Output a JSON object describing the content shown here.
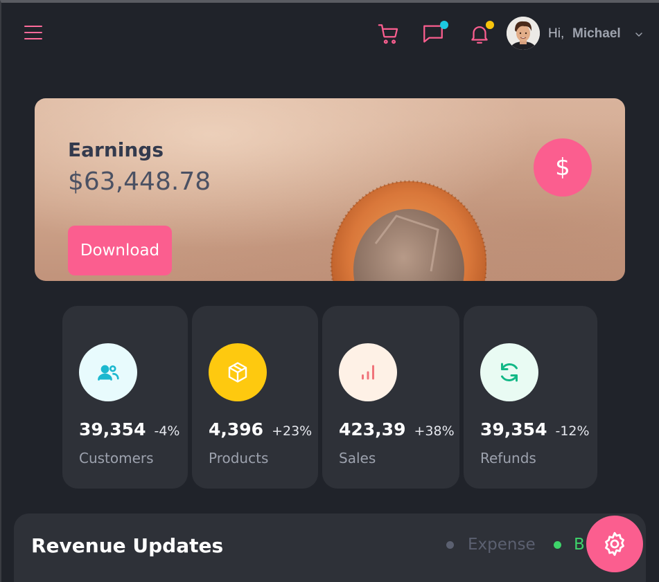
{
  "header": {
    "greeting": "Hi,",
    "user_name": "Michael",
    "icons": [
      "menu-icon",
      "cart-icon",
      "chat-icon",
      "bell-icon",
      "chevron-down-icon"
    ],
    "chat_badge_color": "#1cc8e0",
    "bell_badge_color": "#f8c50c"
  },
  "earnings": {
    "title": "Earnings",
    "value": "$63,448.78",
    "button_label": "Download",
    "icon_symbol": "$"
  },
  "stats": [
    {
      "value": "39,354",
      "change": "-4%",
      "label": "Customers",
      "icon": "customers-icon",
      "icon_bg": "#e8fbfd",
      "icon_color": "#1cb8cf"
    },
    {
      "value": "4,396",
      "change": "+23%",
      "label": "Products",
      "icon": "box-icon",
      "icon_bg": "#fec90f",
      "icon_color": "#ffffff"
    },
    {
      "value": "423,39",
      "change": "+38%",
      "label": "Sales",
      "icon": "bar-chart-icon",
      "icon_bg": "#fef1e6",
      "icon_color": "#f0737a"
    },
    {
      "value": "39,354",
      "change": "-12%",
      "label": "Refunds",
      "icon": "refresh-icon",
      "icon_bg": "#e9fbf3",
      "icon_color": "#12b886"
    }
  ],
  "revenue": {
    "title": "Revenue Updates",
    "legend": [
      {
        "label": "Expense",
        "color": "#5b6070"
      },
      {
        "label": "B",
        "color": "#3ed46a"
      }
    ]
  },
  "colors": {
    "accent": "#fb5e8f",
    "background": "#20232a",
    "card": "#2e3138"
  }
}
